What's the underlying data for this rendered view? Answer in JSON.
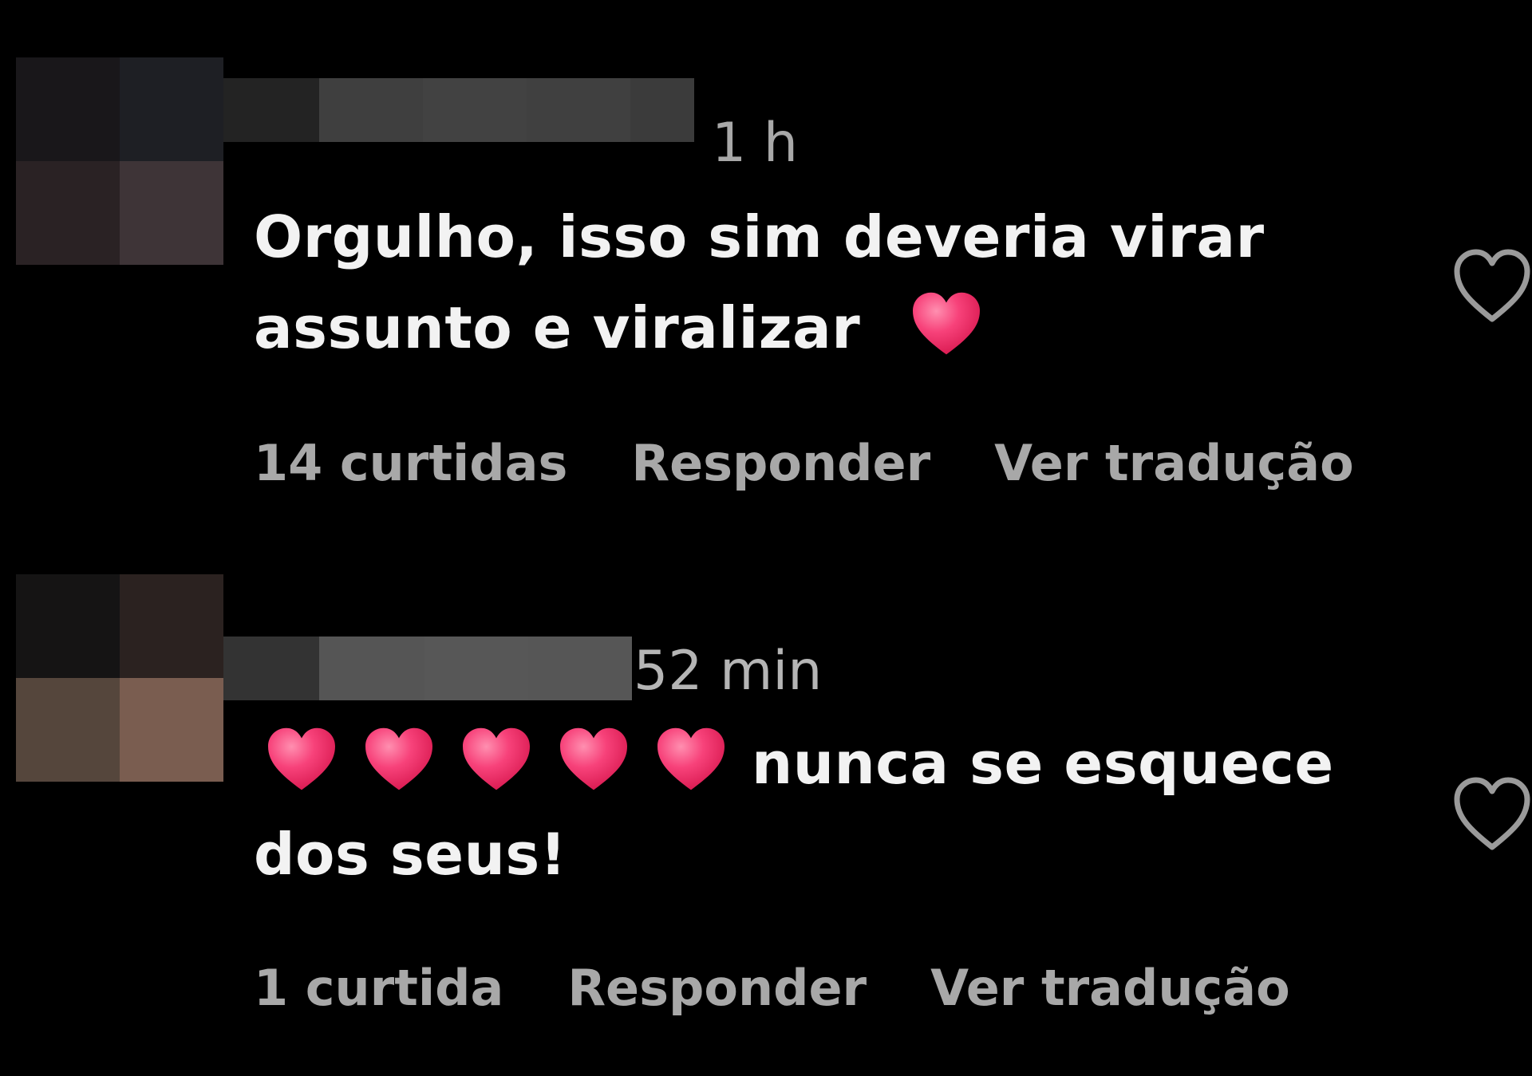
{
  "colors": {
    "background": "#000000",
    "text_primary": "#f2f2f2",
    "text_secondary": "#a8a8a8",
    "heart_emoji": "#f0356a"
  },
  "comments": [
    {
      "timestamp": "1 h",
      "text": "Orgulho, isso sim deveria virar assunto e viralizar",
      "trailing_emoji": "heart-emoji",
      "likes_label": "14 curtidas",
      "reply_label": "Responder",
      "translate_label": "Ver tradução",
      "like_icon": "heart-outline-icon"
    },
    {
      "timestamp": "52 min",
      "leading_emoji_count": 5,
      "leading_emoji": "heart-emoji",
      "text": "nunca se esquece dos seus!",
      "likes_label": "1 curtida",
      "reply_label": "Responder",
      "translate_label": "Ver tradução",
      "like_icon": "heart-outline-icon"
    }
  ]
}
